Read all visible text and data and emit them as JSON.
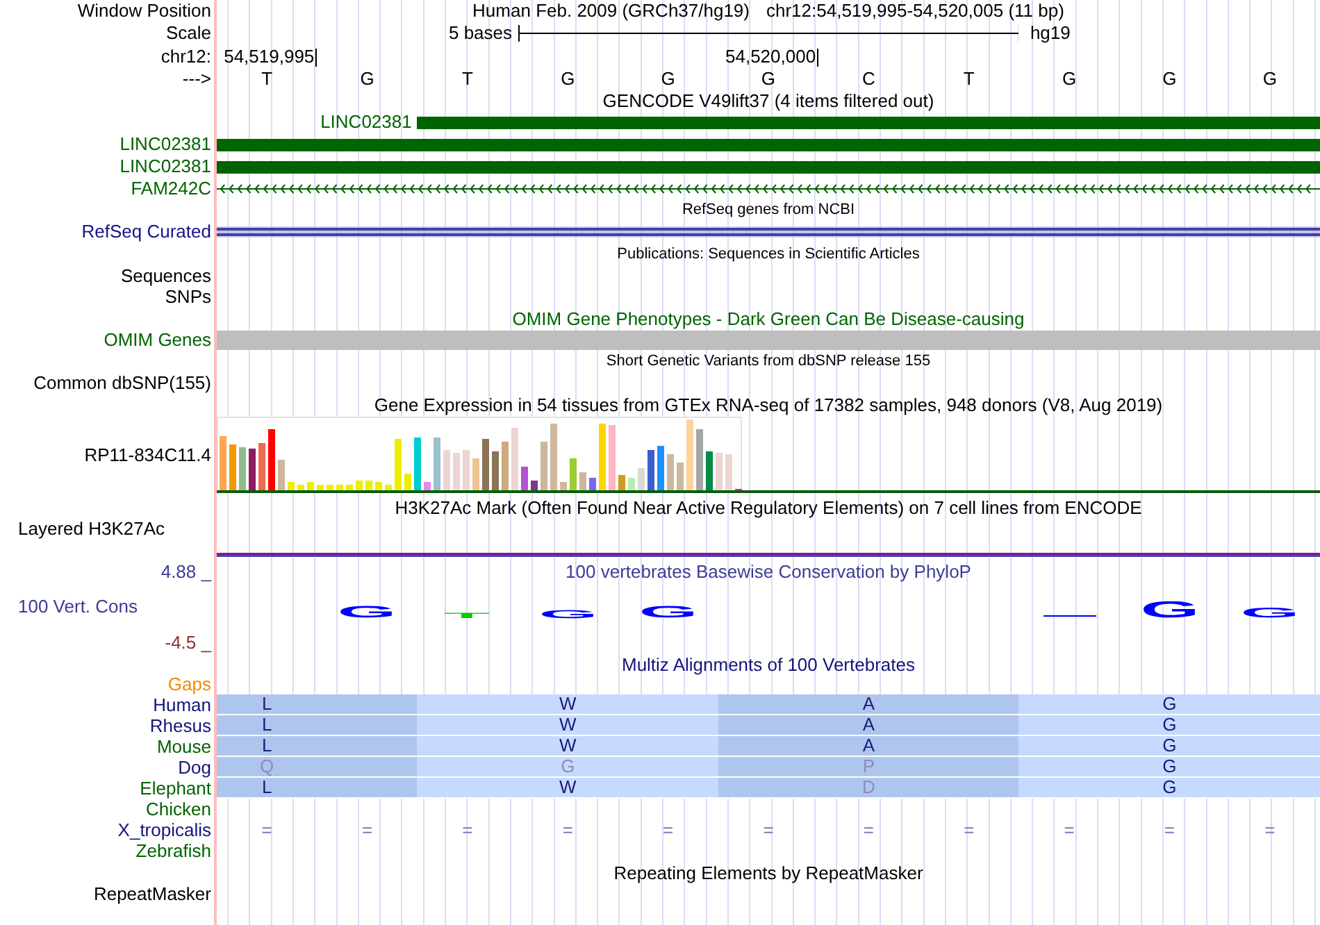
{
  "ruler": {
    "position_label": "Window Position",
    "assembly": "Human Feb. 2009 (GRCh37/hg19)",
    "position": "chr12:54,519,995-54,520,005 (11 bp)",
    "scale_label": "Scale",
    "scale_length": "5 bases",
    "scale_assembly": "hg19",
    "chrom_label": "chr12:",
    "strand_label": "--->",
    "bases": [
      {
        "letter": "T",
        "coordinate": "54,519,995"
      },
      {
        "letter": "G"
      },
      {
        "letter": "T"
      },
      {
        "letter": "G"
      },
      {
        "letter": "G"
      },
      {
        "letter": "G",
        "coordinate": "54,520,000"
      },
      {
        "letter": "C"
      },
      {
        "letter": "T"
      },
      {
        "letter": "G"
      },
      {
        "letter": "G"
      },
      {
        "letter": "G"
      }
    ]
  },
  "tracks": [
    {
      "kind": "gencode",
      "title": "GENCODE V49lift37 (4 items filtered out)",
      "color": "#006400",
      "items": [
        {
          "name": "LINC02381",
          "kind": "partial"
        },
        {
          "name": "LINC02381",
          "kind": "full"
        },
        {
          "name": "LINC02381",
          "kind": "full"
        },
        {
          "name": "FAM242C",
          "kind": "minus_strand"
        }
      ]
    },
    {
      "kind": "refseq",
      "title": "RefSeq genes from NCBI",
      "label": "RefSeq Curated",
      "color": "#14148c"
    },
    {
      "kind": "publications",
      "title": "Publications: Sequences in Scientific Articles",
      "labels": [
        "Sequences",
        "SNPs"
      ]
    },
    {
      "kind": "omim",
      "title": "OMIM Gene Phenotypes - Dark Green Can Be Disease-causing",
      "label": "OMIM Genes",
      "color": "#006400"
    },
    {
      "kind": "dbsnp",
      "title": "Short Genetic Variants from dbSNP release 155",
      "labels": [
        "Common dbSNP(155)"
      ]
    },
    {
      "kind": "gtex",
      "title": "Gene Expression in 54 tissues from GTEx RNA-seq of 17382 samples, 948 donors (V8, Aug 2019)",
      "label": "RP11-834C11.4"
    },
    {
      "kind": "h3k27ac",
      "title": "H3K27Ac Mark (Often Found Near Active Regulatory Elements) on 7 cell lines from ENCODE",
      "label": "Layered H3K27Ac"
    },
    {
      "kind": "phylop",
      "title": "100 vertebrates Basewise Conservation by PhyloP",
      "label": "100 Vert. Cons",
      "color": "#3c3c96",
      "axis_max": "4.88 _",
      "axis_min": "-4.5 _",
      "logo": [
        {
          "kind": "blank"
        },
        {
          "kind": "letter",
          "letter": "G",
          "color": "#0000ff"
        },
        {
          "kind": "letter",
          "letter": "T",
          "color": "#00cc00"
        },
        {
          "kind": "letter",
          "letter": "G",
          "color": "#0000ff"
        },
        {
          "kind": "letter",
          "letter": "G",
          "color": "#0000ff"
        },
        {
          "kind": "blank"
        },
        {
          "kind": "blank"
        },
        {
          "kind": "blank"
        },
        {
          "kind": "line",
          "color": "#0000ff"
        },
        {
          "kind": "letter",
          "letter": "G",
          "color": "#0000ff"
        },
        {
          "kind": "letter",
          "letter": "G",
          "color": "#0000ff"
        }
      ]
    },
    {
      "kind": "multiz",
      "title": "Multiz Alignments of 100 Vertebrates",
      "color": "#14147a",
      "gaps": {
        "label": "Gaps",
        "color": "#f08c00"
      },
      "species": [
        {
          "name": "Human",
          "color": "#14147a",
          "kind": "codons",
          "codons": [
            {
              "aa": "L",
              "match": true
            },
            {
              "aa": "W",
              "match": true
            },
            {
              "aa": "A",
              "match": true
            },
            {
              "aa": "G",
              "match": true
            }
          ]
        },
        {
          "name": "Rhesus",
          "color": "#14147a",
          "kind": "codons",
          "codons": [
            {
              "aa": "L",
              "match": true
            },
            {
              "aa": "W",
              "match": true
            },
            {
              "aa": "A",
              "match": true
            },
            {
              "aa": "G",
              "match": true
            }
          ]
        },
        {
          "name": "Mouse",
          "color": "#006400",
          "kind": "codons",
          "codons": [
            {
              "aa": "L",
              "match": true
            },
            {
              "aa": "W",
              "match": true
            },
            {
              "aa": "A",
              "match": true
            },
            {
              "aa": "G",
              "match": true
            }
          ]
        },
        {
          "name": "Dog",
          "color": "#14147a",
          "kind": "codons",
          "codons": [
            {
              "aa": "Q",
              "match": false
            },
            {
              "aa": "G",
              "match": false
            },
            {
              "aa": "P",
              "match": false
            },
            {
              "aa": "G",
              "match": true
            }
          ]
        },
        {
          "name": "Elephant",
          "color": "#006400",
          "kind": "codons",
          "codons": [
            {
              "aa": "L",
              "match": true
            },
            {
              "aa": "W",
              "match": true
            },
            {
              "aa": "D",
              "match": false
            },
            {
              "aa": "G",
              "match": true
            }
          ]
        },
        {
          "name": "Chicken",
          "color": "#006400",
          "kind": "none"
        },
        {
          "name": "X_tropicalis",
          "color": "#14147a",
          "kind": "marks",
          "marks": [
            "=",
            "=",
            "=",
            "=",
            "=",
            "=",
            "=",
            "=",
            "=",
            "=",
            "="
          ]
        },
        {
          "name": "Zebrafish",
          "color": "#006400",
          "kind": "none"
        }
      ]
    },
    {
      "kind": "repeatmasker",
      "title": "Repeating Elements by RepeatMasker",
      "labels": [
        "RepeatMasker"
      ]
    }
  ]
}
